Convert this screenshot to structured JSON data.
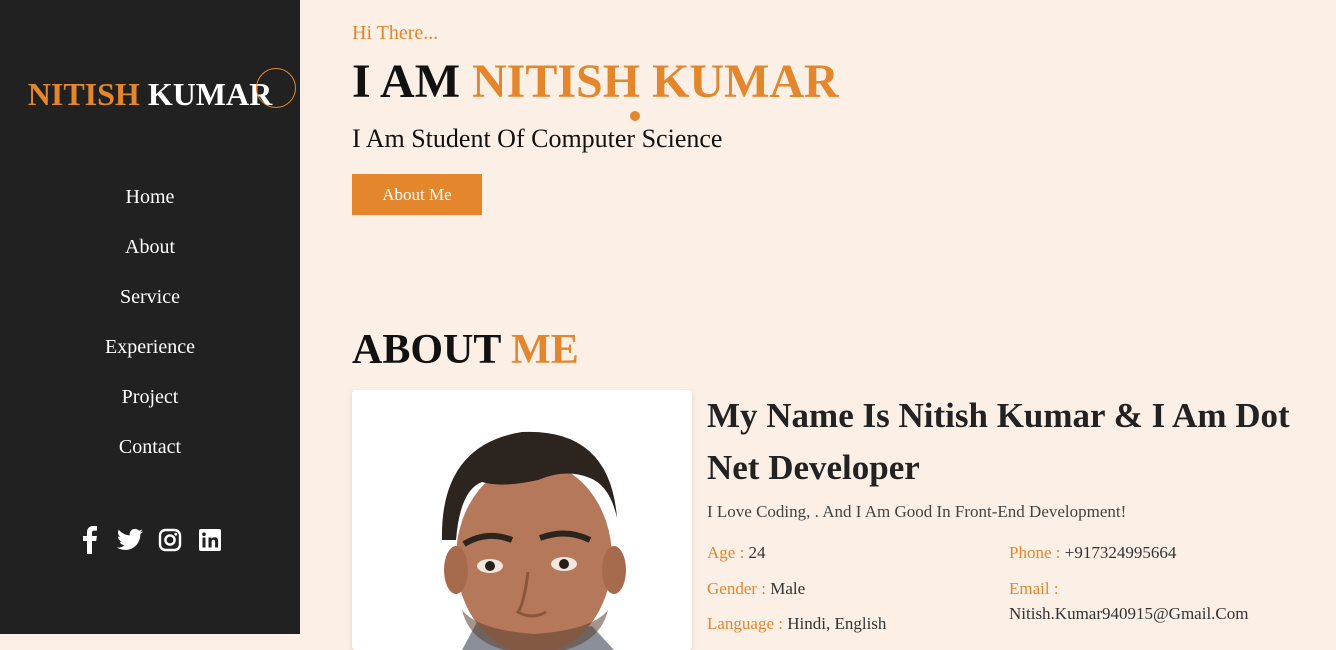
{
  "sidebar": {
    "logo_first": "NITISH",
    "logo_last": "KUMAR",
    "nav": [
      "Home",
      "About",
      "Service",
      "Experience",
      "Project",
      "Contact"
    ],
    "social": [
      "facebook-icon",
      "twitter-icon",
      "instagram-icon",
      "linkedin-icon"
    ]
  },
  "hero": {
    "greeting": "Hi There...",
    "headline_prefix": "I AM",
    "headline_name": "NITISH KUMAR",
    "subtitle": "I Am Student Of Computer Science",
    "button_label": "About Me"
  },
  "about": {
    "title_main": "ABOUT",
    "title_accent": "ME",
    "heading": "My Name Is Nitish Kumar & I Am Dot Net Developer",
    "description": "I Love Coding, . And I Am Good In Front-End Development!",
    "age_label": "Age :",
    "age_value": "24",
    "phone_label": "Phone :",
    "phone_value": "+917324995664",
    "gender_label": "Gender :",
    "gender_value": "Male",
    "email_label": "Email :",
    "email_value": "Nitish.Kumar940915@Gmail.Com",
    "language_label": "Language :",
    "language_value": "Hindi, English"
  },
  "colors": {
    "accent": "#e3862c",
    "sidebar_bg": "#212121",
    "page_bg": "#fcf0e6"
  }
}
